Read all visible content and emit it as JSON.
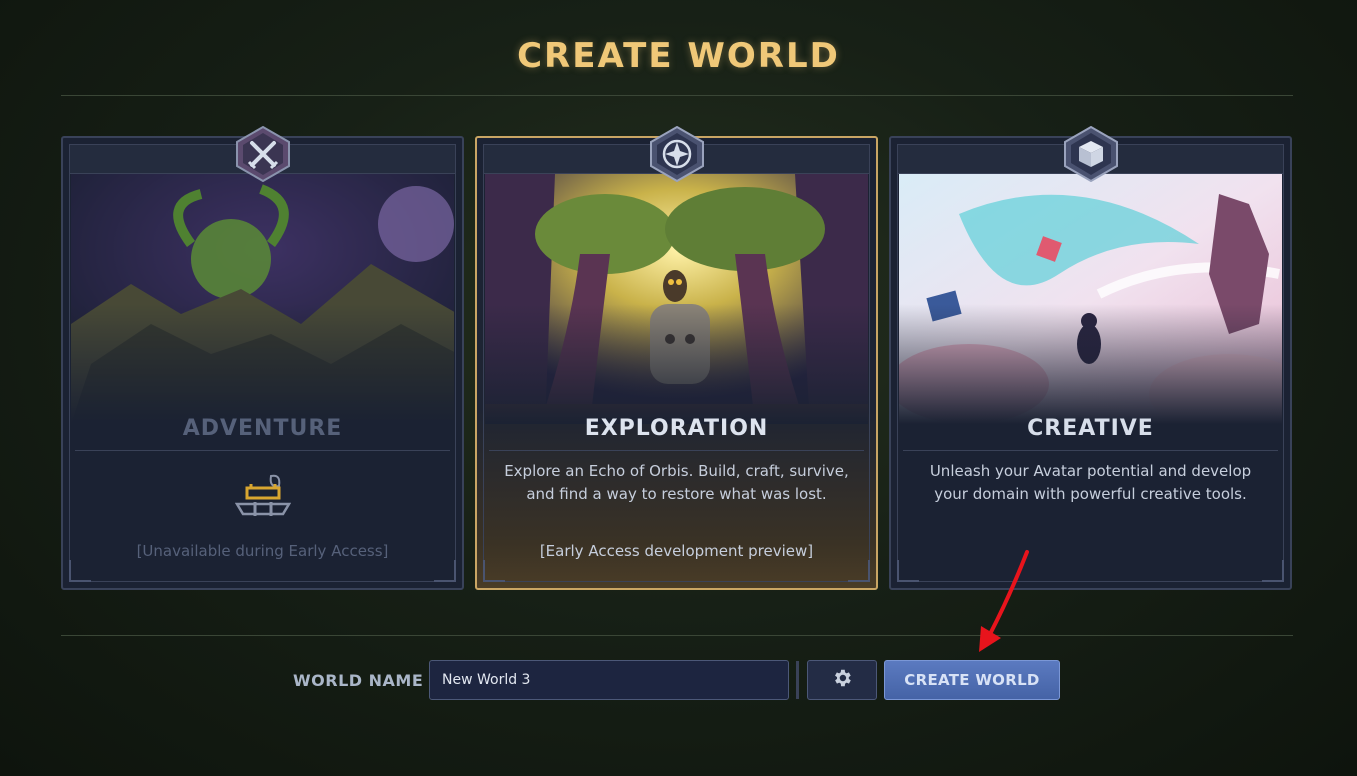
{
  "title": "CREATE WORLD",
  "modes": [
    {
      "name": "ADVENTURE",
      "description": "",
      "note": "[Unavailable during Early Access]",
      "icon": "crossed-swords-icon",
      "state": "disabled"
    },
    {
      "name": "EXPLORATION",
      "description": "Explore an Echo of Orbis. Build, craft, survive, and find a way to restore what was lost.",
      "note": "[Early Access development preview]",
      "icon": "compass-star-icon",
      "state": "selected"
    },
    {
      "name": "CREATIVE",
      "description": "Unleash your Avatar potential and develop your domain with powerful creative tools.",
      "note": "",
      "icon": "cube-icon",
      "state": "available"
    }
  ],
  "form": {
    "world_name_label": "WORLD NAME",
    "world_name_value": "New World 3",
    "create_button_label": "CREATE WORLD"
  },
  "colors": {
    "title": "#f0c878",
    "selected_border": "#c9a564",
    "create_button": "#5272b6",
    "annotation_arrow": "#e8141c"
  }
}
